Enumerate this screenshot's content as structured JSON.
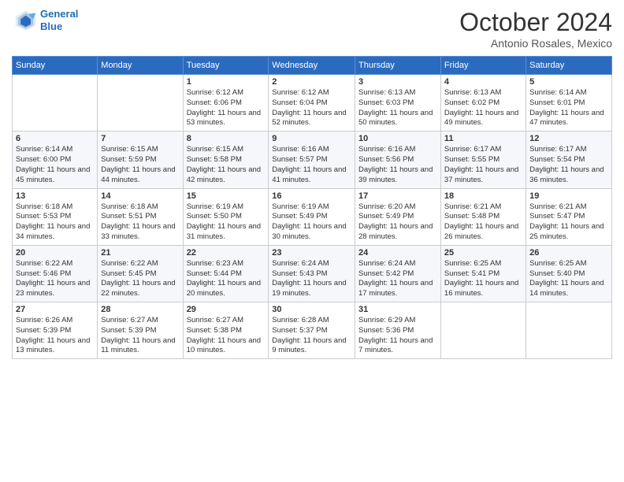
{
  "header": {
    "logo_line1": "General",
    "logo_line2": "Blue",
    "month_title": "October 2024",
    "location": "Antonio Rosales, Mexico"
  },
  "weekdays": [
    "Sunday",
    "Monday",
    "Tuesday",
    "Wednesday",
    "Thursday",
    "Friday",
    "Saturday"
  ],
  "weeks": [
    [
      {
        "day": "",
        "info": ""
      },
      {
        "day": "",
        "info": ""
      },
      {
        "day": "1",
        "info": "Sunrise: 6:12 AM\nSunset: 6:06 PM\nDaylight: 11 hours and 53 minutes."
      },
      {
        "day": "2",
        "info": "Sunrise: 6:12 AM\nSunset: 6:04 PM\nDaylight: 11 hours and 52 minutes."
      },
      {
        "day": "3",
        "info": "Sunrise: 6:13 AM\nSunset: 6:03 PM\nDaylight: 11 hours and 50 minutes."
      },
      {
        "day": "4",
        "info": "Sunrise: 6:13 AM\nSunset: 6:02 PM\nDaylight: 11 hours and 49 minutes."
      },
      {
        "day": "5",
        "info": "Sunrise: 6:14 AM\nSunset: 6:01 PM\nDaylight: 11 hours and 47 minutes."
      }
    ],
    [
      {
        "day": "6",
        "info": "Sunrise: 6:14 AM\nSunset: 6:00 PM\nDaylight: 11 hours and 45 minutes."
      },
      {
        "day": "7",
        "info": "Sunrise: 6:15 AM\nSunset: 5:59 PM\nDaylight: 11 hours and 44 minutes."
      },
      {
        "day": "8",
        "info": "Sunrise: 6:15 AM\nSunset: 5:58 PM\nDaylight: 11 hours and 42 minutes."
      },
      {
        "day": "9",
        "info": "Sunrise: 6:16 AM\nSunset: 5:57 PM\nDaylight: 11 hours and 41 minutes."
      },
      {
        "day": "10",
        "info": "Sunrise: 6:16 AM\nSunset: 5:56 PM\nDaylight: 11 hours and 39 minutes."
      },
      {
        "day": "11",
        "info": "Sunrise: 6:17 AM\nSunset: 5:55 PM\nDaylight: 11 hours and 37 minutes."
      },
      {
        "day": "12",
        "info": "Sunrise: 6:17 AM\nSunset: 5:54 PM\nDaylight: 11 hours and 36 minutes."
      }
    ],
    [
      {
        "day": "13",
        "info": "Sunrise: 6:18 AM\nSunset: 5:53 PM\nDaylight: 11 hours and 34 minutes."
      },
      {
        "day": "14",
        "info": "Sunrise: 6:18 AM\nSunset: 5:51 PM\nDaylight: 11 hours and 33 minutes."
      },
      {
        "day": "15",
        "info": "Sunrise: 6:19 AM\nSunset: 5:50 PM\nDaylight: 11 hours and 31 minutes."
      },
      {
        "day": "16",
        "info": "Sunrise: 6:19 AM\nSunset: 5:49 PM\nDaylight: 11 hours and 30 minutes."
      },
      {
        "day": "17",
        "info": "Sunrise: 6:20 AM\nSunset: 5:49 PM\nDaylight: 11 hours and 28 minutes."
      },
      {
        "day": "18",
        "info": "Sunrise: 6:21 AM\nSunset: 5:48 PM\nDaylight: 11 hours and 26 minutes."
      },
      {
        "day": "19",
        "info": "Sunrise: 6:21 AM\nSunset: 5:47 PM\nDaylight: 11 hours and 25 minutes."
      }
    ],
    [
      {
        "day": "20",
        "info": "Sunrise: 6:22 AM\nSunset: 5:46 PM\nDaylight: 11 hours and 23 minutes."
      },
      {
        "day": "21",
        "info": "Sunrise: 6:22 AM\nSunset: 5:45 PM\nDaylight: 11 hours and 22 minutes."
      },
      {
        "day": "22",
        "info": "Sunrise: 6:23 AM\nSunset: 5:44 PM\nDaylight: 11 hours and 20 minutes."
      },
      {
        "day": "23",
        "info": "Sunrise: 6:24 AM\nSunset: 5:43 PM\nDaylight: 11 hours and 19 minutes."
      },
      {
        "day": "24",
        "info": "Sunrise: 6:24 AM\nSunset: 5:42 PM\nDaylight: 11 hours and 17 minutes."
      },
      {
        "day": "25",
        "info": "Sunrise: 6:25 AM\nSunset: 5:41 PM\nDaylight: 11 hours and 16 minutes."
      },
      {
        "day": "26",
        "info": "Sunrise: 6:25 AM\nSunset: 5:40 PM\nDaylight: 11 hours and 14 minutes."
      }
    ],
    [
      {
        "day": "27",
        "info": "Sunrise: 6:26 AM\nSunset: 5:39 PM\nDaylight: 11 hours and 13 minutes."
      },
      {
        "day": "28",
        "info": "Sunrise: 6:27 AM\nSunset: 5:39 PM\nDaylight: 11 hours and 11 minutes."
      },
      {
        "day": "29",
        "info": "Sunrise: 6:27 AM\nSunset: 5:38 PM\nDaylight: 11 hours and 10 minutes."
      },
      {
        "day": "30",
        "info": "Sunrise: 6:28 AM\nSunset: 5:37 PM\nDaylight: 11 hours and 9 minutes."
      },
      {
        "day": "31",
        "info": "Sunrise: 6:29 AM\nSunset: 5:36 PM\nDaylight: 11 hours and 7 minutes."
      },
      {
        "day": "",
        "info": ""
      },
      {
        "day": "",
        "info": ""
      }
    ]
  ]
}
